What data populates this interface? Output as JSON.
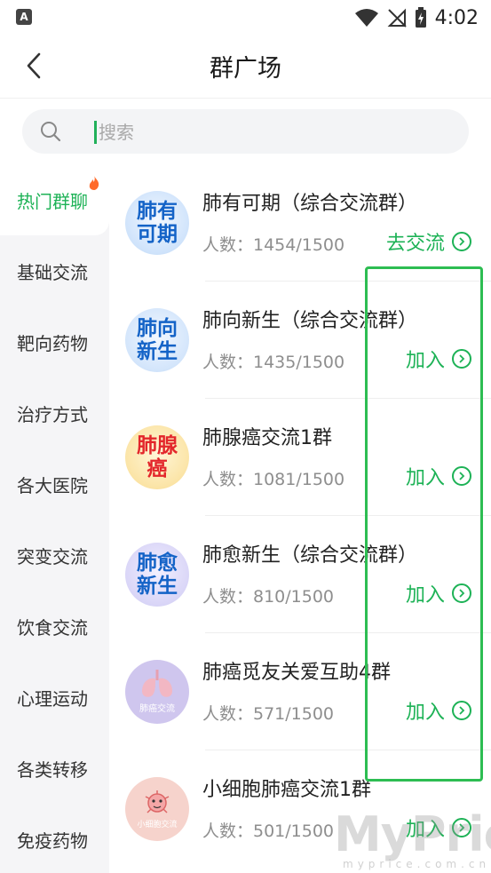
{
  "status_bar": {
    "app_icon_letter": "A",
    "time": "4:02",
    "icons": [
      "wifi-icon",
      "no-signal-icon",
      "battery-charging-icon"
    ]
  },
  "header": {
    "title": "群广场"
  },
  "search": {
    "placeholder": "搜索"
  },
  "sidebar": {
    "items": [
      {
        "label": "热门群聊",
        "active": true,
        "hot": true
      },
      {
        "label": "基础交流"
      },
      {
        "label": "靶向药物"
      },
      {
        "label": "治疗方式"
      },
      {
        "label": "各大医院"
      },
      {
        "label": "突变交流"
      },
      {
        "label": "饮食交流"
      },
      {
        "label": "心理运动"
      },
      {
        "label": "各类转移"
      },
      {
        "label": "免疫药物"
      }
    ]
  },
  "groups": [
    {
      "avatar_text": "肺有\n可期",
      "name": "肺有可期（综合交流群）",
      "count": "人数：1454/1500",
      "action": "去交流"
    },
    {
      "avatar_text": "肺向\n新生",
      "name": "肺向新生（综合交流群）",
      "count": "人数：1435/1500",
      "action": "加入"
    },
    {
      "avatar_text": "肺腺\n癌",
      "name": "肺腺癌交流1群",
      "count": "人数：1081/1500",
      "action": "加入"
    },
    {
      "avatar_text": "肺愈\n新生",
      "name": "肺愈新生（综合交流群）",
      "count": "人数：810/1500",
      "action": "加入"
    },
    {
      "avatar_text": "肺癌交流",
      "name": "肺癌觅友关爱互助4群",
      "count": "人数：571/1500",
      "action": "加入"
    },
    {
      "avatar_text": "小细胞交流",
      "name": "小细胞肺癌交流1群",
      "count": "人数：501/1500",
      "action": "加入"
    }
  ],
  "colors": {
    "accent": "#1db256",
    "highlight_box": "#2dbd52",
    "sidebar_bg": "#f5f5f7"
  },
  "watermark": {
    "brand": "MyPrice",
    "url": "myprice.com.cn"
  }
}
